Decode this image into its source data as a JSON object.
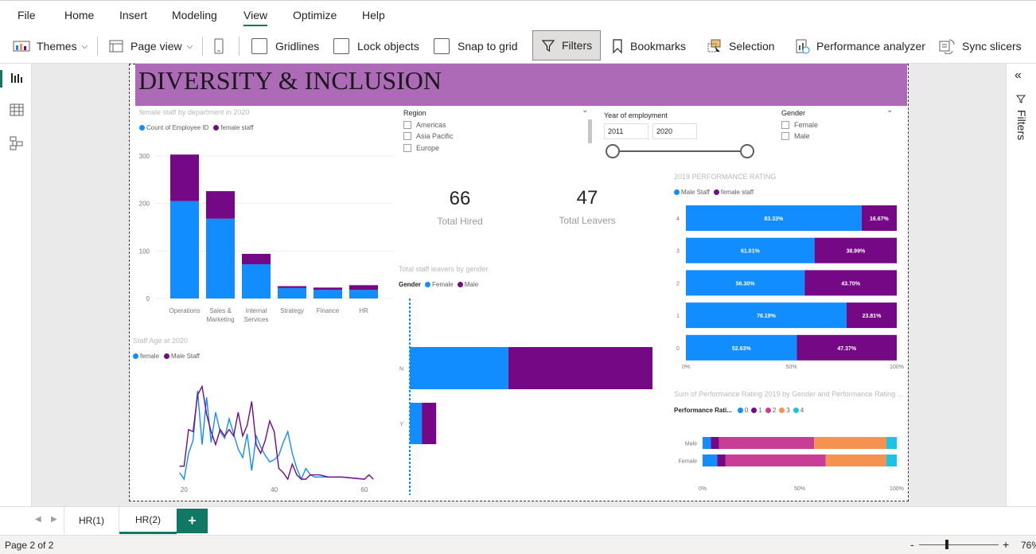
{
  "menu": [
    "File",
    "Home",
    "Insert",
    "Modeling",
    "View",
    "Optimize",
    "Help"
  ],
  "menu_active": "View",
  "ribbon": {
    "themes": "Themes",
    "page_view": "Page view",
    "gridlines": "Gridlines",
    "lock_objects": "Lock objects",
    "snap_to_grid": "Snap to grid",
    "filters": "Filters",
    "bookmarks": "Bookmarks",
    "selection": "Selection",
    "performance_analyzer": "Performance analyzer",
    "sync_slicers": "Sync slicers"
  },
  "right_pane": {
    "filters_label": "Filters"
  },
  "report": {
    "title": "DIVERSITY & INCLUSION",
    "region_slicer": {
      "title": "Region",
      "items": [
        "Americas",
        "Asia Pacific",
        "Europe"
      ]
    },
    "year_slicer": {
      "title": "Year of employment",
      "from": "2011",
      "to": "2020"
    },
    "gender_slicer": {
      "title": "Gender",
      "items": [
        "Female",
        "Male"
      ]
    },
    "kpi_hired": {
      "value": "66",
      "label": "Total Hired"
    },
    "kpi_leavers": {
      "value": "47",
      "label": "Total Leavers"
    }
  },
  "colors": {
    "blue": "#118dff",
    "purple": "#750985",
    "banner": "#ac6ab7",
    "pink": "#c83d95",
    "orange": "#f5924f",
    "cyan": "#1ac4e6",
    "accent": "#117865"
  },
  "tabs": {
    "hr1": "HR(1)",
    "hr2": "HR(2)",
    "add": "+"
  },
  "status": {
    "page": "Page 2 of 2",
    "zoom": "76%"
  },
  "chart_data": [
    {
      "type": "bar",
      "stacked": true,
      "title": "female staff by department in 2020",
      "categories": [
        "Operations",
        "Sales & Marketing",
        "Internal Services",
        "Strategy",
        "Finance",
        "HR"
      ],
      "series": [
        {
          "name": "Count of Employee ID",
          "values": [
            205,
            168,
            72,
            22,
            18,
            18
          ]
        },
        {
          "name": "female staff",
          "values": [
            98,
            58,
            22,
            4,
            5,
            10
          ]
        }
      ],
      "yticks": [
        0,
        100,
        200,
        300
      ],
      "ylim": [
        0,
        310
      ]
    },
    {
      "type": "line",
      "title": "Staff Age at 2020",
      "series": [
        {
          "name": "female",
          "x": [
            19,
            20,
            21,
            22,
            23,
            24,
            25,
            26,
            27,
            28,
            29,
            30,
            31,
            32,
            33,
            34,
            35,
            36,
            37,
            38,
            39,
            40,
            41,
            42,
            43,
            44,
            45,
            46,
            47,
            48,
            49,
            50,
            55,
            60
          ],
          "y": [
            3,
            0,
            12,
            18,
            41,
            16,
            38,
            17,
            31,
            22,
            19,
            28,
            21,
            14,
            10,
            21,
            4,
            20,
            15,
            11,
            8,
            9,
            11,
            17,
            22,
            12,
            5,
            0,
            5,
            2,
            1,
            1,
            1,
            0
          ]
        },
        {
          "name": "Male Staff",
          "x": [
            19,
            20,
            21,
            22,
            23,
            24,
            25,
            26,
            27,
            28,
            29,
            30,
            31,
            32,
            33,
            34,
            35,
            36,
            37,
            38,
            39,
            40,
            41,
            42,
            43,
            44,
            45,
            46,
            47,
            48,
            50,
            52,
            55,
            60,
            61,
            62
          ],
          "y": [
            6,
            6,
            23,
            22,
            39,
            43,
            30,
            22,
            16,
            23,
            20,
            23,
            20,
            31,
            20,
            25,
            36,
            16,
            12,
            18,
            27,
            22,
            5,
            3,
            0,
            7,
            2,
            0,
            0,
            2,
            2,
            1,
            1,
            0,
            2,
            0
          ]
        }
      ],
      "xticks": [
        20,
        40,
        60
      ],
      "xlim": [
        18,
        63
      ],
      "ylim": [
        0,
        45
      ]
    },
    {
      "type": "bar",
      "orientation": "horizontal",
      "stacked": true,
      "title": "Total staff leavers by gender",
      "legend_title": "Gender",
      "categories": [
        "N",
        "Y"
      ],
      "series": [
        {
          "name": "Female",
          "values": [
            41,
            5
          ]
        },
        {
          "name": "Male",
          "values": [
            60,
            6
          ]
        }
      ],
      "xlim": [
        0,
        101
      ]
    },
    {
      "type": "bar",
      "orientation": "horizontal",
      "stacked": true,
      "percent": true,
      "title": "2019 PERFORMANCE RATING",
      "categories": [
        "4",
        "3",
        "2",
        "1",
        "0"
      ],
      "series": [
        {
          "name": "Male Staff",
          "values": [
            83.33,
            61.01,
            56.3,
            76.19,
            52.63
          ],
          "labels": [
            "83.33%",
            "61.01%",
            "56.30%",
            "76.19%",
            "52.63%"
          ]
        },
        {
          "name": "female staff",
          "values": [
            16.67,
            38.99,
            43.7,
            23.81,
            47.37
          ],
          "labels": [
            "16.67%",
            "38.99%",
            "43.70%",
            "23.81%",
            "47.37%"
          ]
        }
      ],
      "xticks": [
        "0%",
        "50%",
        "100%"
      ]
    },
    {
      "type": "bar",
      "orientation": "horizontal",
      "stacked": true,
      "percent": true,
      "title": "Sum of Performance Rating 2019 by Gender and Performance Rating ...",
      "legend_title": "Performance Rati...",
      "categories": [
        "Male",
        "Female"
      ],
      "series": [
        {
          "name": "0",
          "values": [
            4,
            7
          ]
        },
        {
          "name": "1",
          "values": [
            4,
            4
          ]
        },
        {
          "name": "2",
          "values": [
            46,
            48
          ]
        },
        {
          "name": "3",
          "values": [
            35,
            29
          ]
        },
        {
          "name": "4",
          "values": [
            5,
            5
          ]
        }
      ],
      "xticks": [
        "0%",
        "50%",
        "100%"
      ]
    }
  ]
}
